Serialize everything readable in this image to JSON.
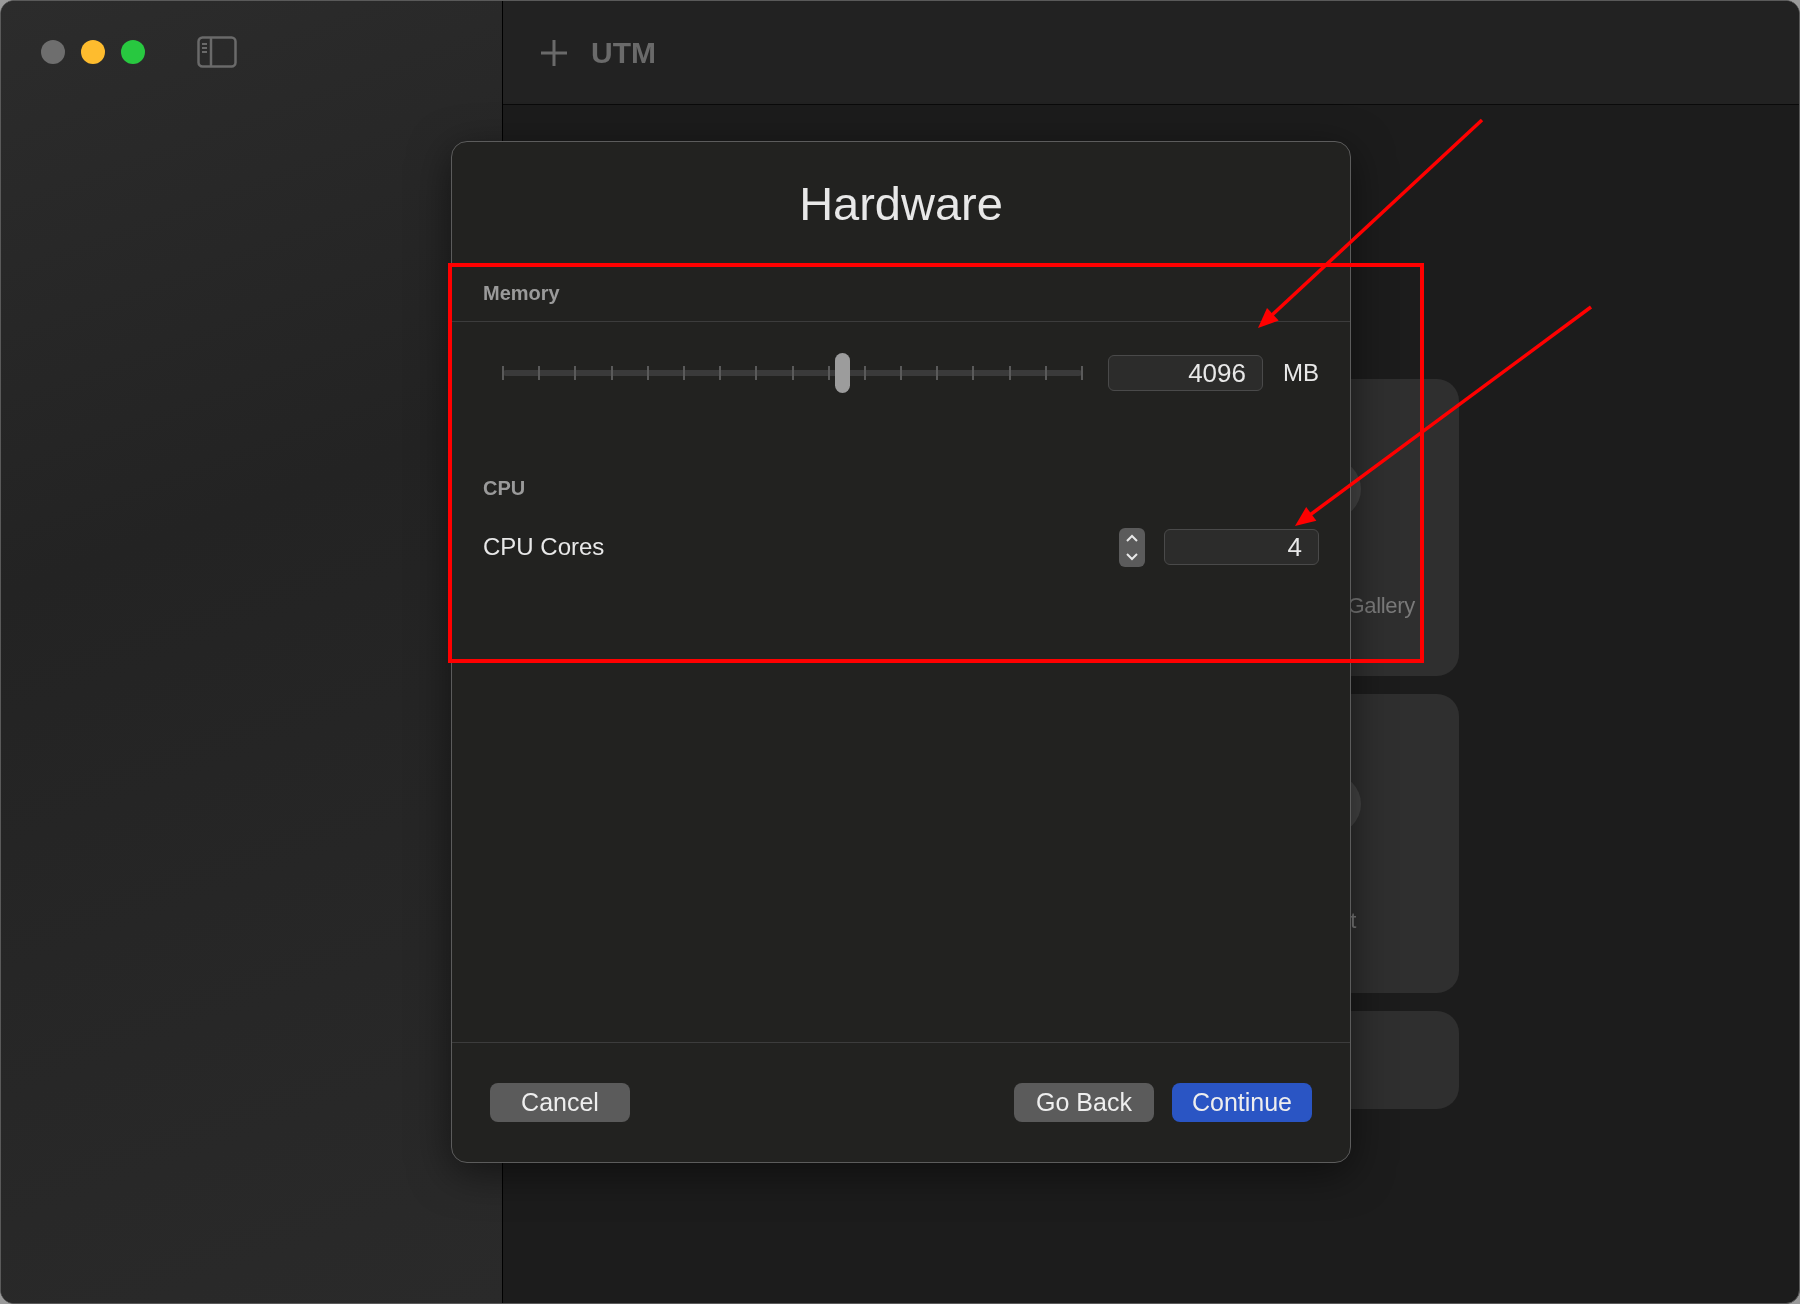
{
  "toolbar": {
    "title": "UTM"
  },
  "background_cards": [
    {
      "label": "Gallery"
    },
    {
      "label": "t"
    }
  ],
  "dialog": {
    "title": "Hardware",
    "sections": [
      {
        "header": "Memory",
        "kind": "slider",
        "level": 0.585,
        "value": "4096",
        "unit": "MB"
      },
      {
        "header": "CPU",
        "kind": "stepper",
        "label": "CPU Cores",
        "value": "4"
      }
    ],
    "buttons": [
      {
        "label": "Cancel",
        "kind": "normal"
      },
      {
        "label": "Go Back",
        "kind": "normal"
      },
      {
        "label": "Continue",
        "kind": "default"
      }
    ]
  },
  "annotations": [
    {
      "kind": "box"
    },
    {
      "kind": "arrow"
    },
    {
      "kind": "arrow"
    }
  ]
}
